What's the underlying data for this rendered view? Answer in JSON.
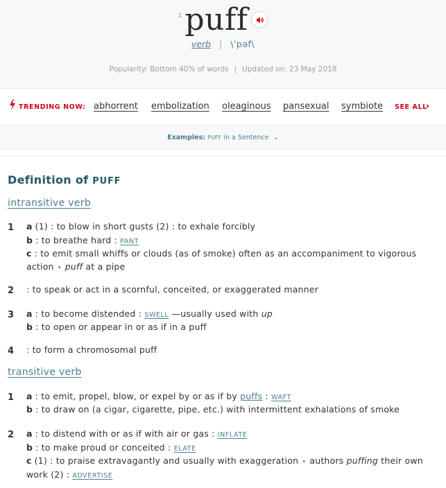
{
  "headword": {
    "homograph": "1",
    "word": "puff",
    "fl": "verb",
    "separator": "|",
    "pronunciation": "\\ˈpəf\\"
  },
  "popularity": {
    "text": "Popularity: Bottom 40% of words",
    "separator": "|",
    "updated": "Updated on: 23 May 2018"
  },
  "trending": {
    "label": "TRENDING NOW:",
    "words": [
      "abhorrent",
      "embolization",
      "oleaginous",
      "pansexual",
      "symbiote"
    ],
    "see_all": "SEE ALL",
    "chevron": "›"
  },
  "examples": {
    "prefix": "Examples:",
    "word": "puff",
    "suffix": "in a Sentence",
    "chevron": "⌄"
  },
  "definition": {
    "title": "Definition of",
    "word": "PUFF"
  },
  "intransitive": {
    "label": "intransitive verb",
    "s1": {
      "num": "1",
      "a_letter": "a",
      "a_text": "(1) : to blow in short gusts (2) : to exhale forcibly",
      "b_letter": "b",
      "b_text": ": to breathe hard :",
      "b_xref": "PANT",
      "c_letter": "c",
      "c_text1": ": to emit small whiffs or clouds (as of smoke) often as an accompaniment to vigorous",
      "c_text2": "action",
      "c_ex_word": "puff",
      "c_ex_rest": "at a pipe"
    },
    "s2": {
      "num": "2",
      "text": ": to speak or act in a scornful, conceited, or exaggerated manner"
    },
    "s3": {
      "num": "3",
      "a_letter": "a",
      "a_text": ": to become distended :",
      "a_xref": "SWELL",
      "a_usage": "—usually used with",
      "a_usage_word": "up",
      "b_letter": "b",
      "b_text": ": to open or appear in or as if in a puff"
    },
    "s4": {
      "num": "4",
      "text": ": to form a chromosomal puff"
    }
  },
  "transitive": {
    "label": "transitive verb",
    "s1": {
      "num": "1",
      "a_letter": "a",
      "a_text": ": to emit, propel, blow, or expel by or as if by",
      "a_link": "puffs",
      "a_colon": ":",
      "a_xref": "WAFT",
      "b_letter": "b",
      "b_text": ": to draw on (a cigar, cigarette, pipe, etc.) with intermittent exhalations of smoke"
    },
    "s2": {
      "num": "2",
      "a_letter": "a",
      "a_text": ": to distend with or as if with air or gas :",
      "a_xref": "INFLATE",
      "b_letter": "b",
      "b_text": ": to make proud or conceited :",
      "b_xref": "ELATE",
      "c_letter": "c",
      "c_text1": "(1) : to praise extravagantly and usually with exaggeration",
      "c_ex1": "authors",
      "c_ex_word": "puffing",
      "c_ex2": "their own",
      "c_text2": "work (2) :",
      "c_xref": "ADVERTISE"
    }
  },
  "colors": {
    "accent": "#4a7d95",
    "trending": "#d0021b",
    "title": "#265667",
    "text": "#303336"
  },
  "icons": {
    "audio": "speaker-icon",
    "trending": "lightning-bolt-icon",
    "see_all": "chevron-right-icon",
    "examples": "chevron-down-icon"
  }
}
